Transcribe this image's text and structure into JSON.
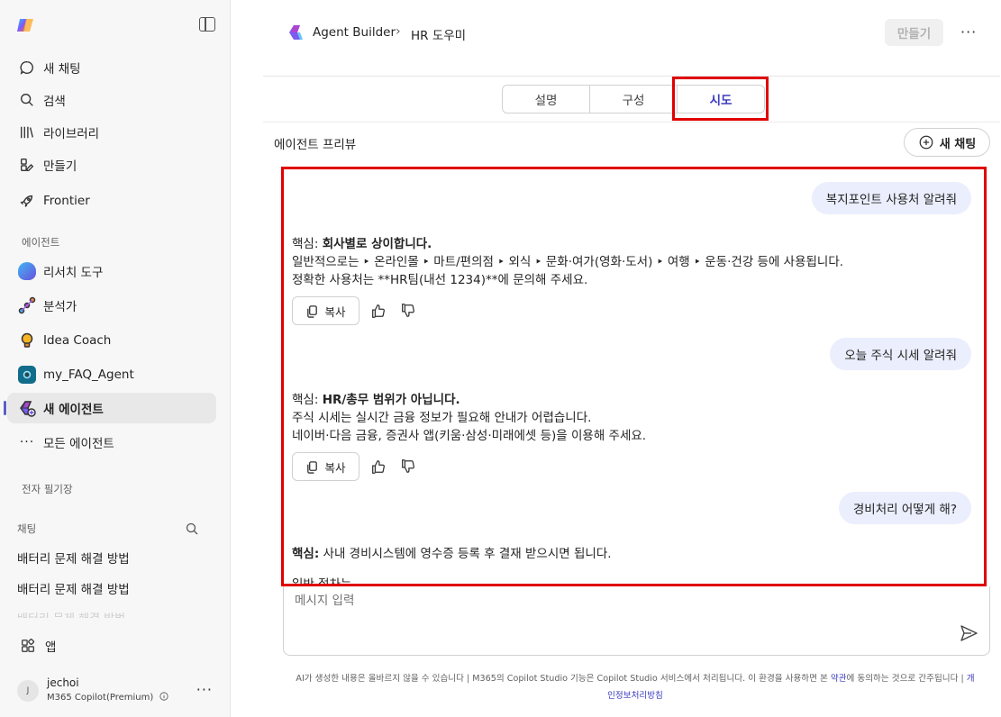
{
  "sidebar": {
    "nav": [
      {
        "label": "새 채팅",
        "icon": "chat-bubble-icon"
      },
      {
        "label": "검색",
        "icon": "search-icon"
      },
      {
        "label": "라이브러리",
        "icon": "library-icon"
      },
      {
        "label": "만들기",
        "icon": "create-icon"
      },
      {
        "label": "Frontier",
        "icon": "rocket-icon"
      }
    ],
    "agents_label": "에이전트",
    "agents": [
      {
        "label": "리서치 도구",
        "color": "#4f6bed"
      },
      {
        "label": "분석가",
        "color": "#c13cc8"
      },
      {
        "label": "Idea Coach",
        "color": "#f2b01e"
      },
      {
        "label": "my_FAQ_Agent",
        "color": "#116d8a"
      },
      {
        "label": "새 에이전트",
        "color": "#6c4fdb"
      }
    ],
    "all_agents": "모든 에이전트",
    "notebook_label": "전자 필기장",
    "chats_label": "채팅",
    "chats": [
      "배터리 문제 해결 방법",
      "배터리 문제 해결 방법"
    ],
    "chat_faded": "배터리 문제 해결 방법",
    "apps": "앱",
    "user": {
      "initial": "J",
      "name": "jechoi",
      "plan": "M365 Copilot(Premium)"
    }
  },
  "header": {
    "breadcrumb_root": "Agent Builder",
    "breadcrumb_current": "HR 도우미",
    "make_button": "만들기"
  },
  "tabs": [
    "설명",
    "구성",
    "시도"
  ],
  "active_tab": "시도",
  "preview": {
    "label": "에이전트 프리뷰",
    "new_chat": "새 채팅"
  },
  "conversation": [
    {
      "question": "복지포인트 사용처 알려줘",
      "answer_prefix": "핵심: ",
      "answer_bold": "회사별로 상이합니다.",
      "line2": "일반적으로는 ‣ 온라인몰 ‣ 마트/편의점 ‣ 외식 ‣ 문화·여가(영화·도서) ‣ 여행 ‣ 운동·건강 등에 사용됩니다.",
      "line3": "정확한 사용처는 **HR팀(내선 1234)**에 문의해 주세요."
    },
    {
      "question": "오늘 주식 시세 알려줘",
      "answer_prefix": "핵심: ",
      "answer_bold": "HR/총무 범위가 아닙니다.",
      "line2": "주식 시세는 실시간 금융 정보가 필요해 안내가 어렵습니다.",
      "line3": "네이버·다음 금융, 증권사 앱(키움·삼성·미래에셋 등)을 이용해 주세요."
    },
    {
      "question": "경비처리 어떻게 해?",
      "answer_prefix": "핵심:",
      "answer_rest": " 사내 경비시스템에 영수증 등록 후 결재 받으시면 됩니다.",
      "line2": "일반 절차는"
    }
  ],
  "copy_label": "복사",
  "input": {
    "placeholder": "메시지 입력"
  },
  "footer": {
    "text": "AI가 생성한 내용은 올바르지 않을 수 있습니다 | M365의 Copilot Studio 기능은 Copilot Studio 서비스에서 처리됩니다. 이 환경을 사용하면 본 ",
    "terms": "약관",
    "text2": "에 동의하는 것으로 간주됩니다 | ",
    "privacy1": "개",
    "privacy2": "인정보처리방침"
  }
}
